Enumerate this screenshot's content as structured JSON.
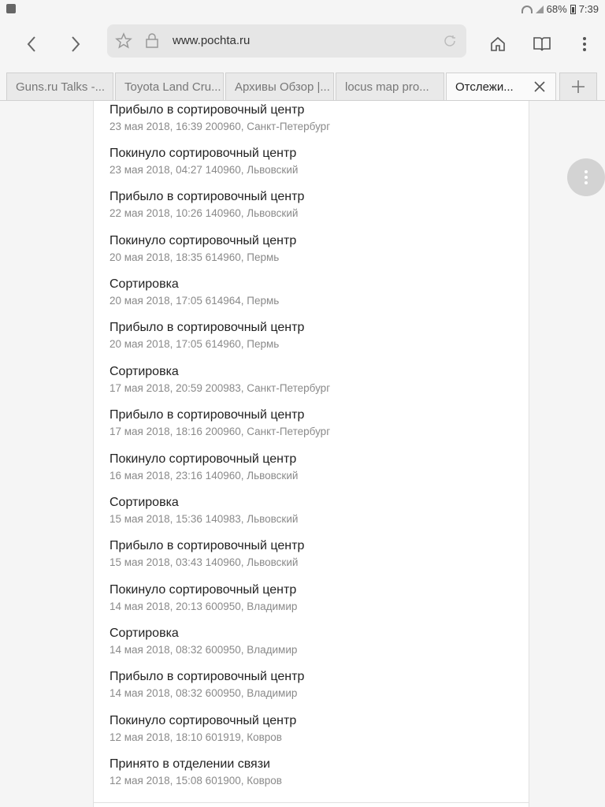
{
  "statusbar": {
    "battery": "68%",
    "time": "7:39"
  },
  "browser": {
    "url": "www.pochta.ru"
  },
  "tabs": [
    {
      "label": "Guns.ru Talks -..."
    },
    {
      "label": "Toyota Land Cru..."
    },
    {
      "label": "Архивы Обзор |..."
    },
    {
      "label": "locus map pro..."
    },
    {
      "label": "Отслежи..."
    }
  ],
  "events": [
    {
      "status": "Прибыло в сортировочный центр",
      "details": "23 мая 2018, 16:39 200960, Санкт-Петербург"
    },
    {
      "status": "Покинуло сортировочный центр",
      "details": "23 мая 2018, 04:27 140960, Львовский"
    },
    {
      "status": "Прибыло в сортировочный центр",
      "details": "22 мая 2018, 10:26 140960, Львовский"
    },
    {
      "status": "Покинуло сортировочный центр",
      "details": "20 мая 2018, 18:35 614960, Пермь"
    },
    {
      "status": "Сортировка",
      "details": "20 мая 2018, 17:05 614964, Пермь"
    },
    {
      "status": "Прибыло в сортировочный центр",
      "details": "20 мая 2018, 17:05 614960, Пермь"
    },
    {
      "status": "Сортировка",
      "details": "17 мая 2018, 20:59 200983, Санкт-Петербург"
    },
    {
      "status": "Прибыло в сортировочный центр",
      "details": "17 мая 2018, 18:16 200960, Санкт-Петербург"
    },
    {
      "status": "Покинуло сортировочный центр",
      "details": "16 мая 2018, 23:16 140960, Львовский"
    },
    {
      "status": "Сортировка",
      "details": "15 мая 2018, 15:36 140983, Львовский"
    },
    {
      "status": "Прибыло в сортировочный центр",
      "details": "15 мая 2018, 03:43 140960, Львовский"
    },
    {
      "status": "Покинуло сортировочный центр",
      "details": "14 мая 2018, 20:13 600950, Владимир"
    },
    {
      "status": "Сортировка",
      "details": "14 мая 2018, 08:32 600950, Владимир"
    },
    {
      "status": "Прибыло в сортировочный центр",
      "details": "14 мая 2018, 08:32 600950, Владимир"
    },
    {
      "status": "Покинуло сортировочный центр",
      "details": "12 мая 2018, 18:10 601919, Ковров"
    },
    {
      "status": "Принято в отделении связи",
      "details": "12 мая 2018, 15:08 601900, Ковров"
    }
  ]
}
